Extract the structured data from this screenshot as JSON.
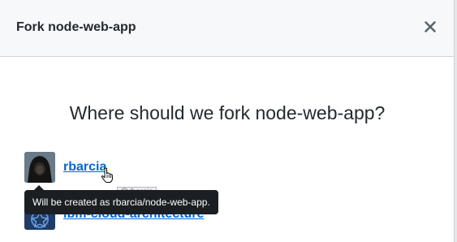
{
  "dialog": {
    "title": "Fork node-web-app",
    "close_icon": "close-icon",
    "question": "Where should we fork node-web-app?"
  },
  "accounts": [
    {
      "name": "rbarcia",
      "avatar": "user-avatar"
    },
    {
      "name": "ibm-cloud-architecture",
      "avatar": "org-avatar"
    }
  ],
  "tooltip": {
    "text": "Will be created as rbarcia/node-web-app."
  },
  "title_tip": {
    "text": "@rbarcia"
  },
  "colors": {
    "link": "#0366d6",
    "tooltip_bg": "#1b1f23",
    "header_bg": "#f6f8fa"
  }
}
